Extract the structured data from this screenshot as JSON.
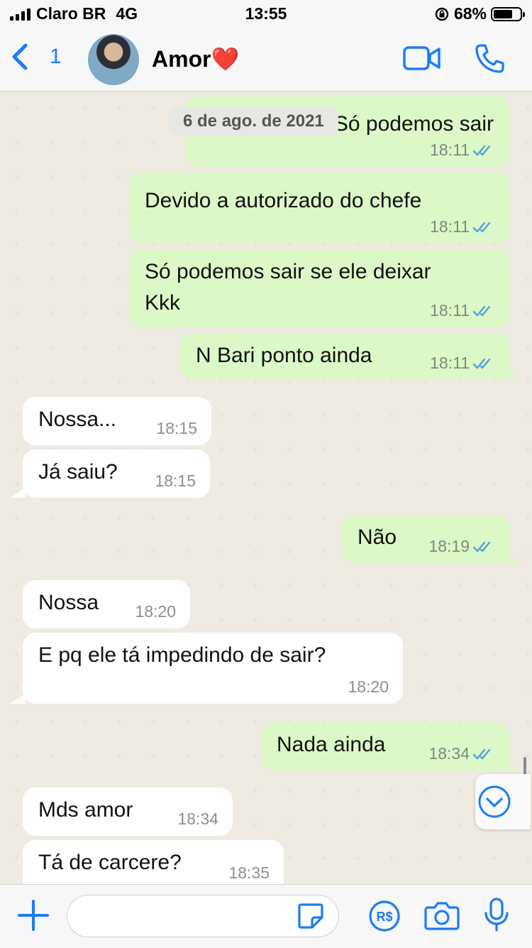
{
  "status_bar": {
    "carrier": "Claro BR",
    "network": "4G",
    "time": "13:55",
    "battery": "68%"
  },
  "header": {
    "back_count": "1",
    "contact_name": "Amor❤️"
  },
  "date_chip": "6 de ago. de 2021",
  "messages": [
    {
      "dir": "out",
      "text": "Só podemos sair",
      "time": "18:11"
    },
    {
      "dir": "out",
      "text": "Devido a autorizado do chefe",
      "time": "18:11"
    },
    {
      "dir": "out",
      "text": "Só podemos sair se ele deixar\nKkk",
      "time": "18:11"
    },
    {
      "dir": "out",
      "text": "N Bari ponto ainda",
      "time": "18:11"
    },
    {
      "dir": "in",
      "text": "Nossa...",
      "time": "18:15"
    },
    {
      "dir": "in",
      "text": "Já saiu?",
      "time": "18:15"
    },
    {
      "dir": "out",
      "text": "Não",
      "time": "18:19"
    },
    {
      "dir": "in",
      "text": "Nossa",
      "time": "18:20"
    },
    {
      "dir": "in",
      "text": "E pq ele tá impedindo de sair?",
      "time": "18:20"
    },
    {
      "dir": "out",
      "text": "Nada ainda",
      "time": "18:34"
    },
    {
      "dir": "in",
      "text": "Mds amor",
      "time": "18:34"
    },
    {
      "dir": "in",
      "text": "Tá de carcere?",
      "time": "18:35"
    }
  ],
  "colors": {
    "accent": "#1a7cf5",
    "outgoing": "#dcf8c6",
    "incoming": "#ffffff",
    "read_ticks": "#4fa3e0"
  },
  "icons": [
    "signal-icon",
    "alarm-lock-icon",
    "battery-icon",
    "back-chevron-icon",
    "video-call-icon",
    "phone-icon",
    "read-ticks-icon",
    "scroll-down-icon",
    "plus-icon",
    "sticker-icon",
    "pix-payment-icon",
    "camera-icon",
    "microphone-icon"
  ]
}
